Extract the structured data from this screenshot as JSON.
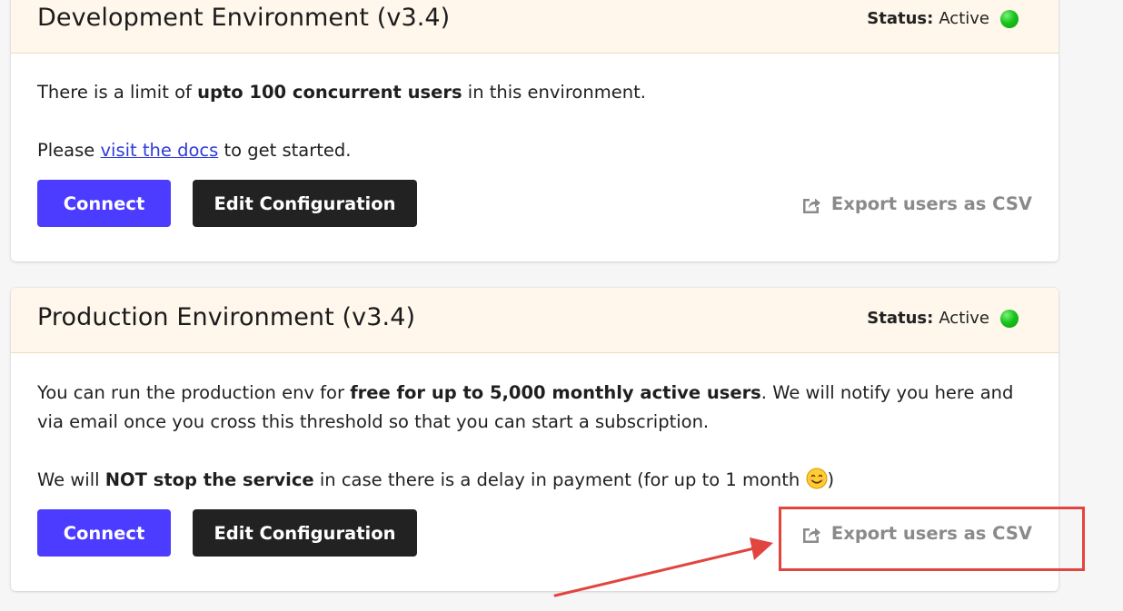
{
  "environments": [
    {
      "title": "Development Environment (v3.4)",
      "status_label": "Status:",
      "status_value": "Active",
      "line1_pre": "There is a limit of ",
      "line1_bold": "upto 100 concurrent users",
      "line1_post": " in this environment.",
      "line2_pre": "Please ",
      "line2_link": "visit the docs",
      "line2_post": " to get started.",
      "connect_label": "Connect",
      "edit_label": "Edit Configuration",
      "export_label": "Export users as CSV"
    },
    {
      "title": "Production Environment (v3.4)",
      "status_label": "Status:",
      "status_value": "Active",
      "line1_pre": "You can run the production env for ",
      "line1_bold": "free for up to 5,000 monthly active users",
      "line1_post": ". We will notify you here and via email once you cross this threshold so that you can start a subscription.",
      "line2_pre": "We will ",
      "line2_bold": "NOT stop the service",
      "line2_post": " in case there is a delay in payment (for up to 1 month ",
      "line2_end": ")",
      "connect_label": "Connect",
      "edit_label": "Edit Configuration",
      "export_label": "Export users as CSV"
    }
  ],
  "colors": {
    "connect": "#4b3cff",
    "edit": "#222222",
    "header_bg": "#fff6ec",
    "status_dot": "#19c41c",
    "annotation": "#e2453f",
    "link": "#2f3bd8"
  },
  "icons": {
    "export": "share-export-icon",
    "emoji": "smiling-face-emoji",
    "status": "status-dot-icon"
  }
}
